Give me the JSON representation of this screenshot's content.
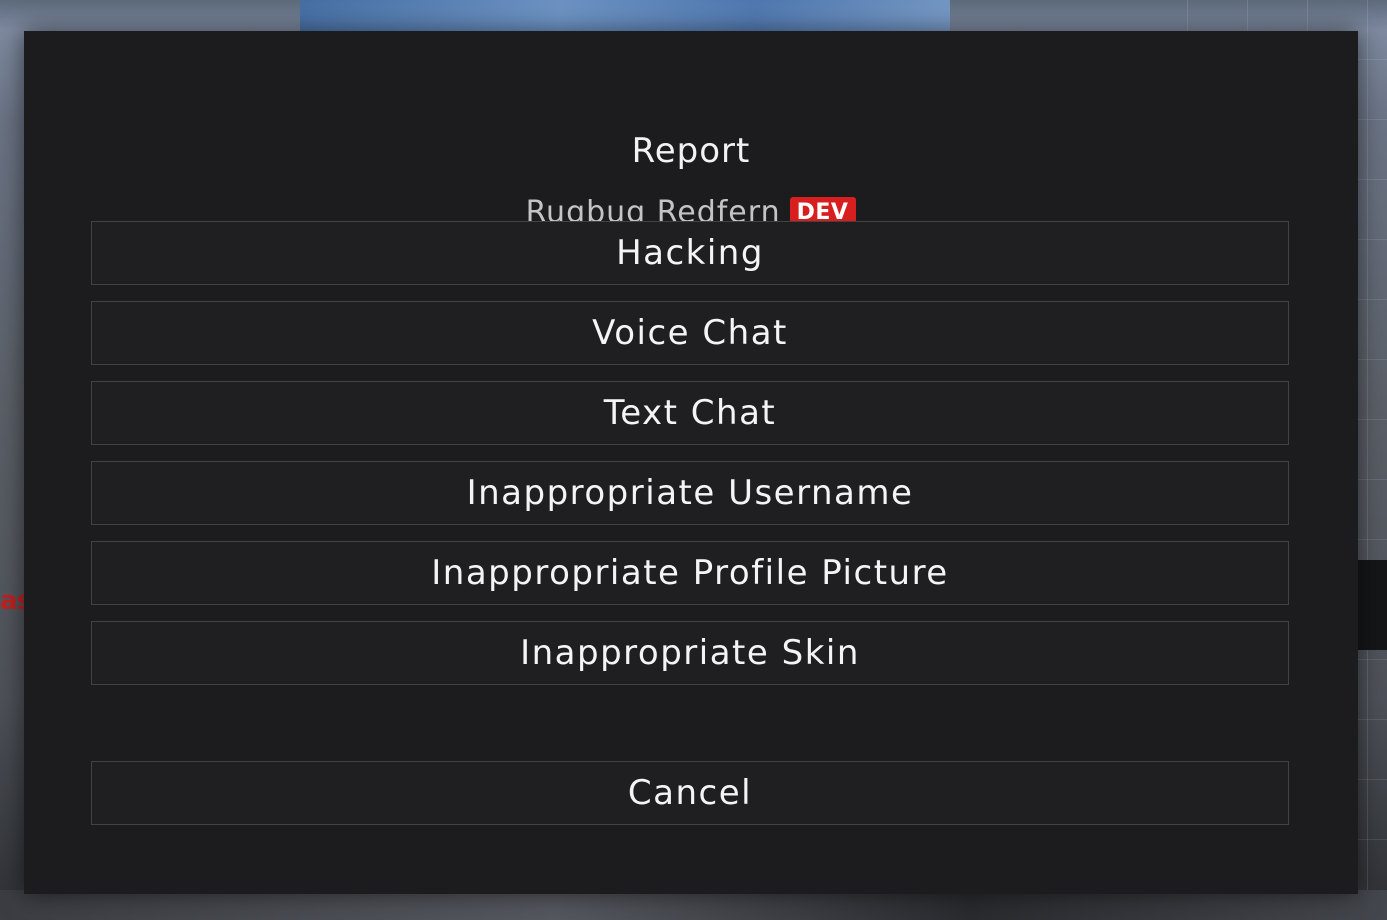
{
  "background": {
    "partial_text": "as"
  },
  "dialog": {
    "title": "Report",
    "player_name": "Rugbug Redfern",
    "player_badge": "DEV",
    "badge_color": "#d71f1f",
    "options": [
      "Hacking",
      "Voice Chat",
      "Text Chat",
      "Inappropriate Username",
      "Inappropriate Profile Picture",
      "Inappropriate Skin"
    ],
    "cancel_label": "Cancel"
  }
}
